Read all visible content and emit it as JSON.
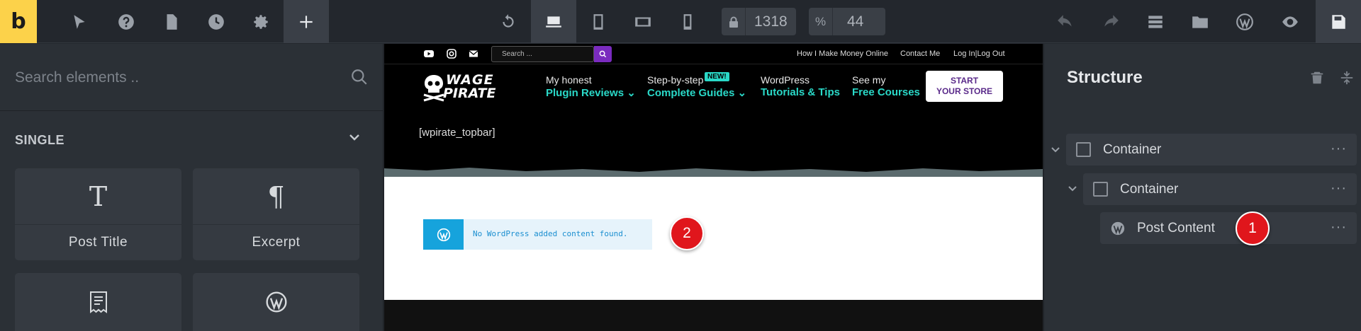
{
  "toolbar": {
    "logo": "b",
    "width_label": "1318",
    "width_prefix": "🔒",
    "zoom_label": "44",
    "zoom_prefix": "%"
  },
  "left_panel": {
    "search_placeholder": "Search elements ..",
    "section": "SINGLE",
    "tiles": [
      {
        "label": "Post Title",
        "icon": "T"
      },
      {
        "label": "Excerpt",
        "icon": "¶"
      },
      {
        "label": "",
        "icon": "receipt-icon"
      },
      {
        "label": "",
        "icon": "wordpress-icon"
      }
    ]
  },
  "canvas": {
    "search_placeholder": "Search ...",
    "util_links": [
      "How I Make Money Online",
      "Contact Me",
      "Log In|Log Out"
    ],
    "brand_line1": "WAGE",
    "brand_line2": "PIRATE",
    "nav": [
      {
        "top": "My honest",
        "bottom": "Plugin Reviews ⌄"
      },
      {
        "top": "Step-by-step",
        "bottom": "Complete Guides ⌄"
      },
      {
        "top": "WordPress",
        "bottom": "Tutorials & Tips"
      },
      {
        "top": "See my",
        "bottom": "Free Courses"
      }
    ],
    "new_badge": "NEW!",
    "cta_line1": "START",
    "cta_line2": "YOUR STORE",
    "shortcode": "[wpirate_topbar]",
    "notice": "No WordPress added content found."
  },
  "structure": {
    "title": "Structure",
    "items": [
      {
        "label": "Container"
      },
      {
        "label": "Container"
      },
      {
        "label": "Post Content"
      }
    ]
  },
  "badges": {
    "one": "1",
    "two": "2"
  },
  "colors": {
    "accent_yellow": "#fcd24a",
    "teal": "#2ad9c8",
    "badge_red": "#e0161c",
    "notice_blue": "#16a3dc"
  }
}
